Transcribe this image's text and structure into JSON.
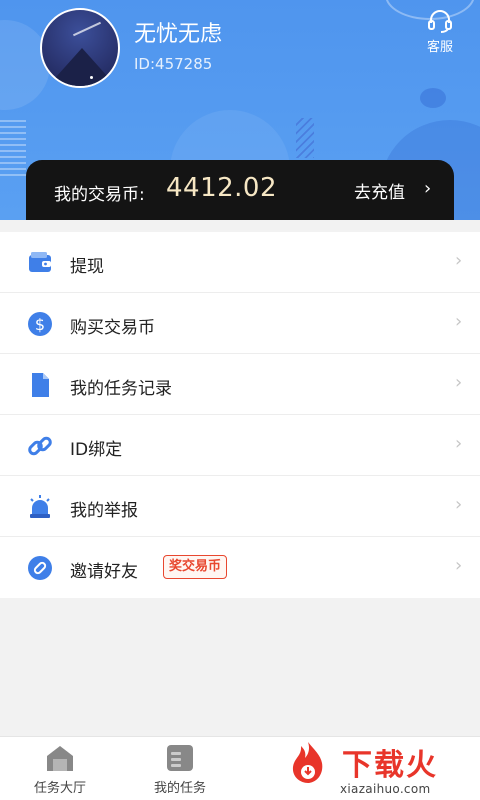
{
  "user": {
    "name": "无忧无虑",
    "id": "ID:457285"
  },
  "header": {
    "service_label": "客服"
  },
  "balance": {
    "label": "我的交易币:",
    "value": "4412.02",
    "recharge_label": "去充值",
    "chevron": "›"
  },
  "menu": {
    "items": [
      {
        "label": "提现",
        "icon": "wallet-icon"
      },
      {
        "label": "购买交易币",
        "icon": "dollar-icon"
      },
      {
        "label": "我的任务记录",
        "icon": "document-icon"
      },
      {
        "label": "ID绑定",
        "icon": "link-icon"
      },
      {
        "label": "我的举报",
        "icon": "alarm-icon"
      },
      {
        "label": "邀请好友",
        "icon": "paperclip-icon",
        "badge": "奖交易币"
      }
    ],
    "arrow": "›"
  },
  "tabs": [
    {
      "label": "任务大厅",
      "icon": "home-icon"
    },
    {
      "label": "我的任务",
      "icon": "tasks-icon"
    }
  ],
  "watermark": {
    "text": "下载火",
    "url": "xiazaihuo.com"
  },
  "colors": {
    "header_blue": "#4f95ee",
    "accent_blue": "#3f7fe8",
    "balance_gold": "#f6e7c4",
    "badge_red": "#e8472f"
  }
}
